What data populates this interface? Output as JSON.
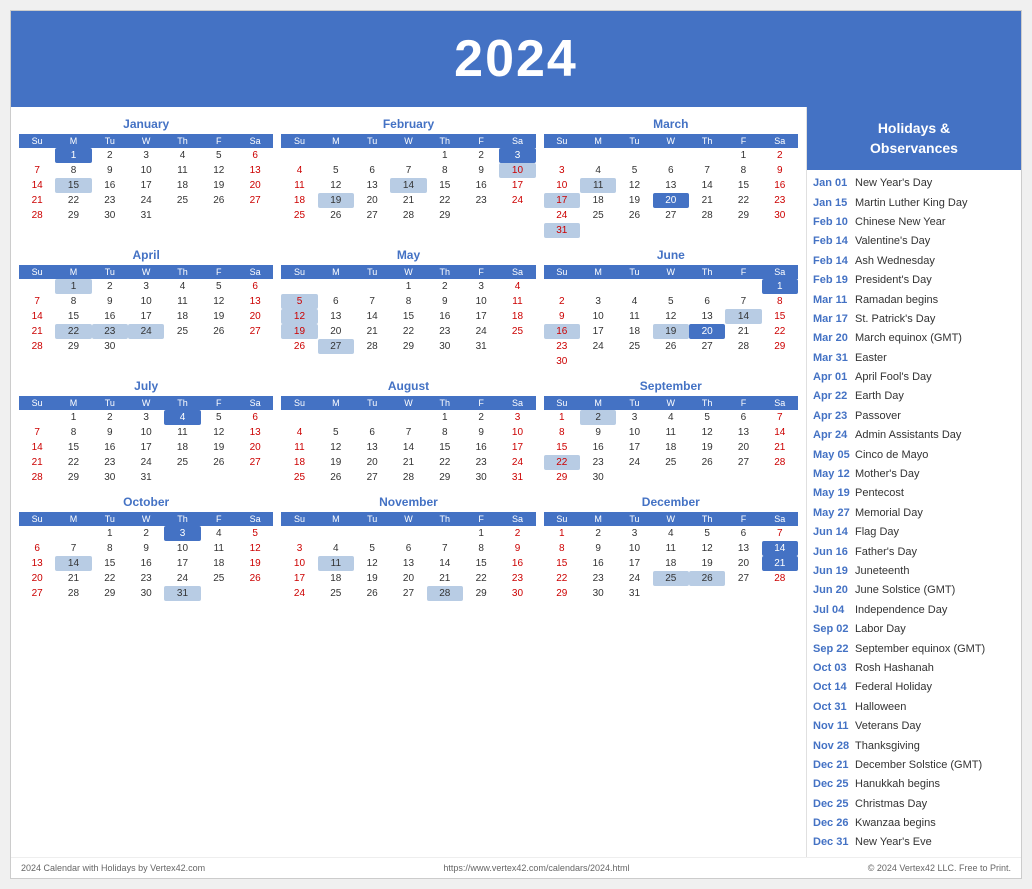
{
  "header": {
    "year": "2024"
  },
  "sidebar": {
    "title": "Holidays &\nObservances",
    "items": [
      {
        "date": "Jan 01",
        "name": "New Year's Day"
      },
      {
        "date": "Jan 15",
        "name": "Martin Luther King Day"
      },
      {
        "date": "Feb 10",
        "name": "Chinese New Year"
      },
      {
        "date": "Feb 14",
        "name": "Valentine's Day"
      },
      {
        "date": "Feb 14",
        "name": "Ash Wednesday"
      },
      {
        "date": "Feb 19",
        "name": "President's Day"
      },
      {
        "date": "Mar 11",
        "name": "Ramadan begins"
      },
      {
        "date": "Mar 17",
        "name": "St. Patrick's Day"
      },
      {
        "date": "Mar 20",
        "name": "March equinox (GMT)"
      },
      {
        "date": "Mar 31",
        "name": "Easter"
      },
      {
        "date": "Apr 01",
        "name": "April Fool's Day"
      },
      {
        "date": "Apr 22",
        "name": "Earth Day"
      },
      {
        "date": "Apr 23",
        "name": "Passover"
      },
      {
        "date": "Apr 24",
        "name": "Admin Assistants Day"
      },
      {
        "date": "May 05",
        "name": "Cinco de Mayo"
      },
      {
        "date": "May 12",
        "name": "Mother's Day"
      },
      {
        "date": "May 19",
        "name": "Pentecost"
      },
      {
        "date": "May 27",
        "name": "Memorial Day"
      },
      {
        "date": "Jun 14",
        "name": "Flag Day"
      },
      {
        "date": "Jun 16",
        "name": "Father's Day"
      },
      {
        "date": "Jun 19",
        "name": "Juneteenth"
      },
      {
        "date": "Jun 20",
        "name": "June Solstice (GMT)"
      },
      {
        "date": "Jul 04",
        "name": "Independence Day"
      },
      {
        "date": "Sep 02",
        "name": "Labor Day"
      },
      {
        "date": "Sep 22",
        "name": "September equinox (GMT)"
      },
      {
        "date": "Oct 03",
        "name": "Rosh Hashanah"
      },
      {
        "date": "Oct 14",
        "name": "Federal Holiday"
      },
      {
        "date": "Oct 31",
        "name": "Halloween"
      },
      {
        "date": "Nov 11",
        "name": "Veterans Day"
      },
      {
        "date": "Nov 28",
        "name": "Thanksgiving"
      },
      {
        "date": "Dec 21",
        "name": "December Solstice (GMT)"
      },
      {
        "date": "Dec 25",
        "name": "Hanukkah begins"
      },
      {
        "date": "Dec 25",
        "name": "Christmas Day"
      },
      {
        "date": "Dec 26",
        "name": "Kwanzaa begins"
      },
      {
        "date": "Dec 31",
        "name": "New Year's Eve"
      }
    ]
  },
  "footer": {
    "left": "2024 Calendar with Holidays by Vertex42.com",
    "center": "https://www.vertex42.com/calendars/2024.html",
    "right": "© 2024 Vertex42 LLC. Free to Print."
  },
  "months": [
    {
      "name": "January",
      "days_header": [
        "Su",
        "M",
        "Tu",
        "W",
        "Th",
        "F",
        "Sa"
      ],
      "weeks": [
        [
          "",
          "1",
          "2",
          "3",
          "4",
          "5",
          "6"
        ],
        [
          "7",
          "8",
          "9",
          "10",
          "11",
          "12",
          "13"
        ],
        [
          "14",
          "15",
          "16",
          "17",
          "18",
          "19",
          "20"
        ],
        [
          "21",
          "22",
          "23",
          "24",
          "25",
          "26",
          "27"
        ],
        [
          "28",
          "29",
          "30",
          "31",
          "",
          "",
          ""
        ]
      ],
      "highlights": {
        "1": "dark",
        "15": "light"
      },
      "saturday_col": 6,
      "sunday_col": 0
    },
    {
      "name": "February",
      "days_header": [
        "Su",
        "M",
        "Tu",
        "W",
        "Th",
        "F",
        "Sa"
      ],
      "weeks": [
        [
          "",
          "",
          "",
          "",
          "1",
          "2",
          "3"
        ],
        [
          "4",
          "5",
          "6",
          "7",
          "8",
          "9",
          "10"
        ],
        [
          "11",
          "12",
          "13",
          "14",
          "15",
          "16",
          "17"
        ],
        [
          "18",
          "19",
          "20",
          "21",
          "22",
          "23",
          "24"
        ],
        [
          "25",
          "26",
          "27",
          "28",
          "29",
          "",
          ""
        ]
      ],
      "highlights": {
        "3": "dark",
        "10": "light",
        "14": "light",
        "19": "light"
      },
      "saturday_col": 6,
      "sunday_col": 0
    },
    {
      "name": "March",
      "days_header": [
        "Su",
        "M",
        "Tu",
        "W",
        "Th",
        "F",
        "Sa"
      ],
      "weeks": [
        [
          "",
          "",
          "",
          "",
          "",
          "1",
          "2"
        ],
        [
          "3",
          "4",
          "5",
          "6",
          "7",
          "8",
          "9"
        ],
        [
          "10",
          "11",
          "12",
          "13",
          "14",
          "15",
          "16"
        ],
        [
          "17",
          "18",
          "19",
          "20",
          "21",
          "22",
          "23"
        ],
        [
          "24",
          "25",
          "26",
          "27",
          "28",
          "29",
          "30"
        ],
        [
          "31",
          "",
          "",
          "",
          "",
          "",
          ""
        ]
      ],
      "highlights": {
        "11": "light",
        "17": "light",
        "20": "dark",
        "31": "light"
      },
      "saturday_col": 6,
      "sunday_col": 0
    },
    {
      "name": "April",
      "days_header": [
        "Su",
        "M",
        "Tu",
        "W",
        "Th",
        "F",
        "Sa"
      ],
      "weeks": [
        [
          "",
          "1",
          "2",
          "3",
          "4",
          "5",
          "6"
        ],
        [
          "7",
          "8",
          "9",
          "10",
          "11",
          "12",
          "13"
        ],
        [
          "14",
          "15",
          "16",
          "17",
          "18",
          "19",
          "20"
        ],
        [
          "21",
          "22",
          "23",
          "24",
          "25",
          "26",
          "27"
        ],
        [
          "28",
          "29",
          "30",
          "",
          "",
          "",
          ""
        ]
      ],
      "highlights": {
        "1": "light",
        "22": "light",
        "23": "light",
        "24": "light"
      },
      "saturday_col": 6,
      "sunday_col": 0
    },
    {
      "name": "May",
      "days_header": [
        "Su",
        "M",
        "Tu",
        "W",
        "Th",
        "F",
        "Sa"
      ],
      "weeks": [
        [
          "",
          "",
          "",
          "1",
          "2",
          "3",
          "4"
        ],
        [
          "5",
          "6",
          "7",
          "8",
          "9",
          "10",
          "11"
        ],
        [
          "12",
          "13",
          "14",
          "15",
          "16",
          "17",
          "18"
        ],
        [
          "19",
          "20",
          "21",
          "22",
          "23",
          "24",
          "25"
        ],
        [
          "26",
          "27",
          "28",
          "29",
          "30",
          "31",
          ""
        ]
      ],
      "highlights": {
        "5": "light",
        "12": "light",
        "19": "light",
        "27": "light"
      },
      "saturday_col": 6,
      "sunday_col": 0
    },
    {
      "name": "June",
      "days_header": [
        "Su",
        "M",
        "Tu",
        "W",
        "Th",
        "F",
        "Sa"
      ],
      "weeks": [
        [
          "",
          "",
          "",
          "",
          "",
          "",
          "1"
        ],
        [
          "2",
          "3",
          "4",
          "5",
          "6",
          "7",
          "8"
        ],
        [
          "9",
          "10",
          "11",
          "12",
          "13",
          "14",
          "15"
        ],
        [
          "16",
          "17",
          "18",
          "19",
          "20",
          "21",
          "22"
        ],
        [
          "23",
          "24",
          "25",
          "26",
          "27",
          "28",
          "29"
        ],
        [
          "30",
          "",
          "",
          "",
          "",
          "",
          ""
        ]
      ],
      "highlights": {
        "1": "dark",
        "14": "light",
        "16": "light",
        "19": "light",
        "20": "dark"
      },
      "saturday_col": 6,
      "sunday_col": 0
    },
    {
      "name": "July",
      "days_header": [
        "Su",
        "M",
        "Tu",
        "W",
        "Th",
        "F",
        "Sa"
      ],
      "weeks": [
        [
          "",
          "1",
          "2",
          "3",
          "4",
          "5",
          "6"
        ],
        [
          "7",
          "8",
          "9",
          "10",
          "11",
          "12",
          "13"
        ],
        [
          "14",
          "15",
          "16",
          "17",
          "18",
          "19",
          "20"
        ],
        [
          "21",
          "22",
          "23",
          "24",
          "25",
          "26",
          "27"
        ],
        [
          "28",
          "29",
          "30",
          "31",
          "",
          "",
          ""
        ]
      ],
      "highlights": {
        "4": "dark"
      },
      "saturday_col": 6,
      "sunday_col": 0
    },
    {
      "name": "August",
      "days_header": [
        "Su",
        "M",
        "Tu",
        "W",
        "Th",
        "F",
        "Sa"
      ],
      "weeks": [
        [
          "",
          "",
          "",
          "",
          "1",
          "2",
          "3"
        ],
        [
          "4",
          "5",
          "6",
          "7",
          "8",
          "9",
          "10"
        ],
        [
          "11",
          "12",
          "13",
          "14",
          "15",
          "16",
          "17"
        ],
        [
          "18",
          "19",
          "20",
          "21",
          "22",
          "23",
          "24"
        ],
        [
          "25",
          "26",
          "27",
          "28",
          "29",
          "30",
          "31"
        ]
      ],
      "highlights": {},
      "saturday_col": 6,
      "sunday_col": 0
    },
    {
      "name": "September",
      "days_header": [
        "Su",
        "M",
        "Tu",
        "W",
        "Th",
        "F",
        "Sa"
      ],
      "weeks": [
        [
          "1",
          "2",
          "3",
          "4",
          "5",
          "6",
          "7"
        ],
        [
          "8",
          "9",
          "10",
          "11",
          "12",
          "13",
          "14"
        ],
        [
          "15",
          "16",
          "17",
          "18",
          "19",
          "20",
          "21"
        ],
        [
          "22",
          "23",
          "24",
          "25",
          "26",
          "27",
          "28"
        ],
        [
          "29",
          "30",
          "",
          "",
          "",
          "",
          ""
        ]
      ],
      "highlights": {
        "2": "light",
        "22": "light"
      },
      "saturday_col": 6,
      "sunday_col": 0
    },
    {
      "name": "October",
      "days_header": [
        "Su",
        "M",
        "Tu",
        "W",
        "Th",
        "F",
        "Sa"
      ],
      "weeks": [
        [
          "",
          "",
          "1",
          "2",
          "3",
          "4",
          "5"
        ],
        [
          "6",
          "7",
          "8",
          "9",
          "10",
          "11",
          "12"
        ],
        [
          "13",
          "14",
          "15",
          "16",
          "17",
          "18",
          "19"
        ],
        [
          "20",
          "21",
          "22",
          "23",
          "24",
          "25",
          "26"
        ],
        [
          "27",
          "28",
          "29",
          "30",
          "31",
          "",
          ""
        ]
      ],
      "highlights": {
        "3": "dark",
        "14": "light",
        "31": "light"
      },
      "saturday_col": 6,
      "sunday_col": 0
    },
    {
      "name": "November",
      "days_header": [
        "Su",
        "M",
        "Tu",
        "W",
        "Th",
        "F",
        "Sa"
      ],
      "weeks": [
        [
          "",
          "",
          "",
          "",
          "",
          "1",
          "2"
        ],
        [
          "3",
          "4",
          "5",
          "6",
          "7",
          "8",
          "9"
        ],
        [
          "10",
          "11",
          "12",
          "13",
          "14",
          "15",
          "16"
        ],
        [
          "17",
          "18",
          "19",
          "20",
          "21",
          "22",
          "23"
        ],
        [
          "24",
          "25",
          "26",
          "27",
          "28",
          "29",
          "30"
        ]
      ],
      "highlights": {
        "11": "light",
        "28": "light"
      },
      "saturday_col": 6,
      "sunday_col": 0
    },
    {
      "name": "December",
      "days_header": [
        "Su",
        "M",
        "Tu",
        "W",
        "Th",
        "F",
        "Sa"
      ],
      "weeks": [
        [
          "1",
          "2",
          "3",
          "4",
          "5",
          "6",
          "7"
        ],
        [
          "8",
          "9",
          "10",
          "11",
          "12",
          "13",
          "14"
        ],
        [
          "15",
          "16",
          "17",
          "18",
          "19",
          "20",
          "21"
        ],
        [
          "22",
          "23",
          "24",
          "25",
          "26",
          "27",
          "28"
        ],
        [
          "29",
          "30",
          "31",
          "",
          "",
          "",
          ""
        ]
      ],
      "highlights": {
        "14": "dark",
        "21": "dark",
        "25": "light",
        "26": "light"
      },
      "saturday_col": 6,
      "sunday_col": 0
    }
  ]
}
